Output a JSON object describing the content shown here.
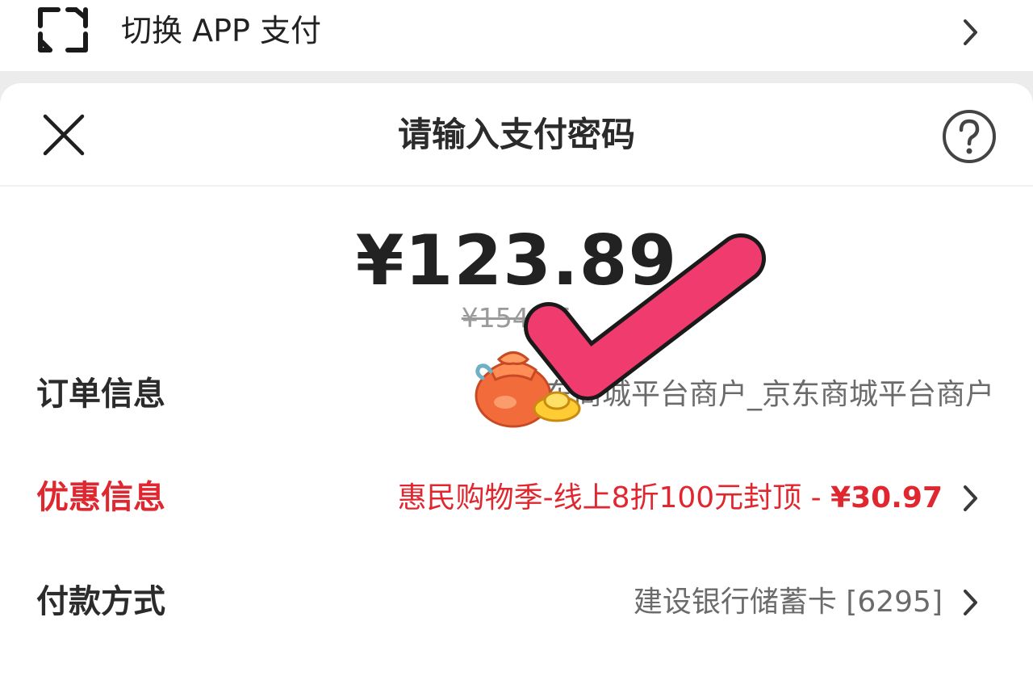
{
  "top_bar": {
    "switch_label": "切换 APP 支付"
  },
  "sheet": {
    "title": "请输入支付密码",
    "amount": "¥123.89",
    "original_amount": "¥154.86"
  },
  "rows": {
    "order": {
      "label": "订单信息",
      "value": "京东商城平台商户_京东商城平台商户"
    },
    "discount": {
      "label": "优惠信息",
      "value": "惠民购物季-线上8折100元封顶 - ",
      "amount": "¥30.97"
    },
    "payment": {
      "label": "付款方式",
      "value": "建设银行储蓄卡 [6295]"
    }
  },
  "colors": {
    "accent_red": "#e0272f",
    "check_pink": "#f03b6e"
  },
  "icons": {
    "switch": "switch-app-icon",
    "chevron": "chevron-right-icon",
    "close": "close-icon",
    "help": "help-icon",
    "sticker": "check-mark-sticker-icon"
  }
}
